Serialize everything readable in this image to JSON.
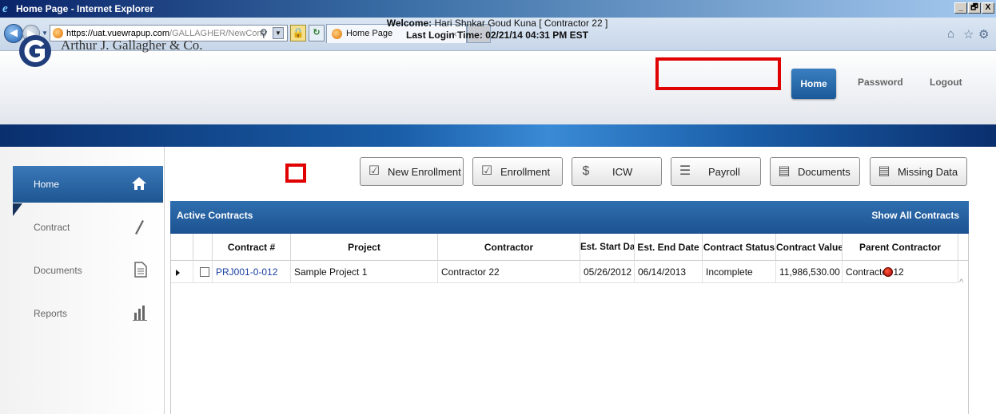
{
  "browser": {
    "window_title": "Home Page - Internet Explorer",
    "url_domain": "https://uat.vuewrapup.com",
    "url_rest": "/GALLAGHER/NewContr",
    "tab_label": "Home Page",
    "tab_close": "×",
    "window_buttons": [
      "_",
      "🗗",
      "X"
    ]
  },
  "header": {
    "brand": "Arthur J. Gallagher & Co.",
    "welcome_label": "Welcome:",
    "welcome_value": "Hari Shnkar Goud Kuna [ Contractor 22 ]",
    "last_login_label": "Last Login Time:",
    "last_login_value": "02/21/14 04:31 PM EST",
    "nav": {
      "home": "Home",
      "password": "Password",
      "logout": "Logout"
    }
  },
  "sidebar": {
    "items": [
      {
        "label": "Home",
        "icon": "home-icon",
        "active": true
      },
      {
        "label": "Contract",
        "icon": "pencil-icon",
        "active": false
      },
      {
        "label": "Documents",
        "icon": "document-icon",
        "active": false
      },
      {
        "label": "Reports",
        "icon": "bar-chart-icon",
        "active": false
      }
    ]
  },
  "toolbar": {
    "new_enrollment": "New Enrollment",
    "enrollment": "Enrollment",
    "icw": "ICW",
    "payroll": "Payroll",
    "documents": "Documents",
    "missing_data": "Missing Data"
  },
  "panel": {
    "title": "Active Contracts",
    "show_all": "Show All Contracts"
  },
  "grid": {
    "columns": [
      "Contract #",
      "Project",
      "Contractor",
      "Est. Start Date",
      "Est. End Date",
      "Contract Status",
      "Contract Value",
      "Parent Contractor"
    ],
    "rows": [
      {
        "contract_no": "PRJ001-0-012",
        "project": "Sample Project 1",
        "contractor": "Contractor 22",
        "start": "05/26/2012",
        "end": "06/14/2013",
        "status": "Incomplete",
        "status_color": "#c00000",
        "value": "11,986,530.00",
        "parent": "Contractor 12"
      }
    ]
  },
  "colors": {
    "accent_blue": "#1d5290",
    "highlight_red": "#e00000"
  }
}
